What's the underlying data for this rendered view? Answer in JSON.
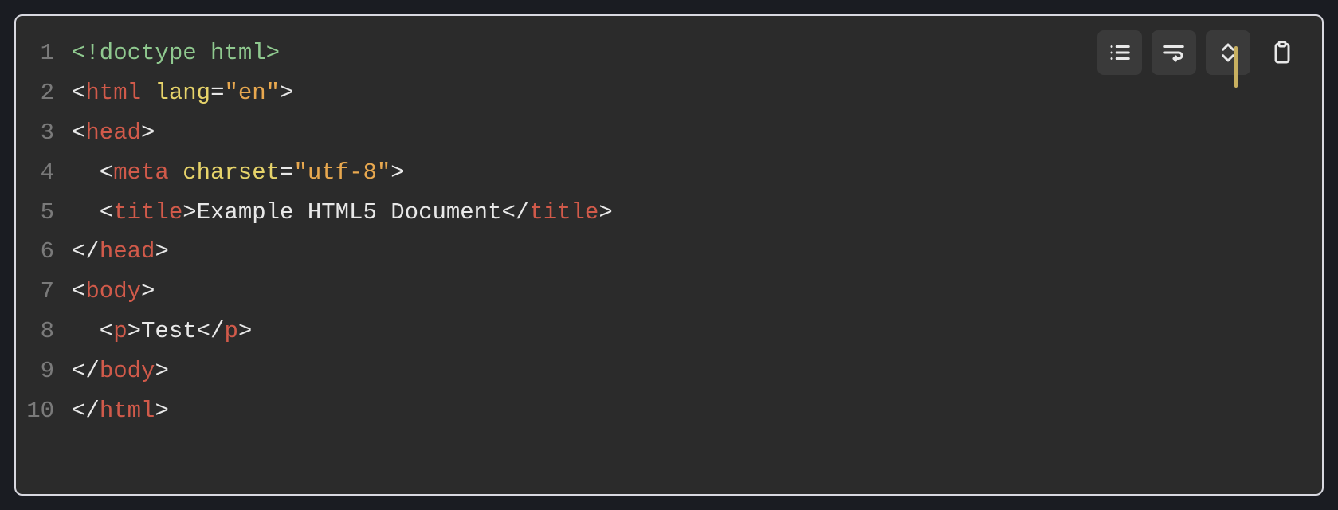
{
  "toolbar": {
    "buttons": [
      {
        "name": "line-numbers-icon",
        "title": "Toggle line numbers"
      },
      {
        "name": "word-wrap-icon",
        "title": "Toggle word wrap"
      },
      {
        "name": "expand-icon",
        "title": "Expand"
      },
      {
        "name": "copy-icon",
        "title": "Copy to clipboard"
      }
    ]
  },
  "code": {
    "language": "html",
    "line_numbers": [
      "1",
      "2",
      "3",
      "4",
      "5",
      "6",
      "7",
      "8",
      "9",
      "10"
    ],
    "plain": "<!doctype html>\n<html lang=\"en\">\n<head>\n  <meta charset=\"utf-8\">\n  <title>Example HTML5 Document</title>\n</head>\n<body>\n  <p>Test</p>\n</body>\n</html>",
    "lines": [
      {
        "indent": 0,
        "tokens": [
          {
            "t": "doctype",
            "v": "<!doctype html>"
          }
        ]
      },
      {
        "indent": 0,
        "tokens": [
          {
            "t": "bracket",
            "v": "<"
          },
          {
            "t": "tag",
            "v": "html"
          },
          {
            "t": "text",
            "v": " "
          },
          {
            "t": "attr",
            "v": "lang"
          },
          {
            "t": "op",
            "v": "="
          },
          {
            "t": "str",
            "v": "\"en\""
          },
          {
            "t": "bracket",
            "v": ">"
          }
        ]
      },
      {
        "indent": 0,
        "tokens": [
          {
            "t": "bracket",
            "v": "<"
          },
          {
            "t": "tag",
            "v": "head"
          },
          {
            "t": "bracket",
            "v": ">"
          }
        ]
      },
      {
        "indent": 1,
        "tokens": [
          {
            "t": "bracket",
            "v": "<"
          },
          {
            "t": "tag",
            "v": "meta"
          },
          {
            "t": "text",
            "v": " "
          },
          {
            "t": "attr",
            "v": "charset"
          },
          {
            "t": "op",
            "v": "="
          },
          {
            "t": "str",
            "v": "\"utf-8\""
          },
          {
            "t": "bracket",
            "v": ">"
          }
        ]
      },
      {
        "indent": 1,
        "tokens": [
          {
            "t": "bracket",
            "v": "<"
          },
          {
            "t": "tag",
            "v": "title"
          },
          {
            "t": "bracket",
            "v": ">"
          },
          {
            "t": "text",
            "v": "Example HTML5 Document"
          },
          {
            "t": "bracket",
            "v": "</"
          },
          {
            "t": "tag",
            "v": "title"
          },
          {
            "t": "bracket",
            "v": ">"
          }
        ]
      },
      {
        "indent": 0,
        "tokens": [
          {
            "t": "bracket",
            "v": "</"
          },
          {
            "t": "tag",
            "v": "head"
          },
          {
            "t": "bracket",
            "v": ">"
          }
        ]
      },
      {
        "indent": 0,
        "tokens": [
          {
            "t": "bracket",
            "v": "<"
          },
          {
            "t": "tag",
            "v": "body"
          },
          {
            "t": "bracket",
            "v": ">"
          }
        ]
      },
      {
        "indent": 1,
        "tokens": [
          {
            "t": "bracket",
            "v": "<"
          },
          {
            "t": "tag",
            "v": "p"
          },
          {
            "t": "bracket",
            "v": ">"
          },
          {
            "t": "text",
            "v": "Test"
          },
          {
            "t": "bracket",
            "v": "</"
          },
          {
            "t": "tag",
            "v": "p"
          },
          {
            "t": "bracket",
            "v": ">"
          }
        ]
      },
      {
        "indent": 0,
        "tokens": [
          {
            "t": "bracket",
            "v": "</"
          },
          {
            "t": "tag",
            "v": "body"
          },
          {
            "t": "bracket",
            "v": ">"
          }
        ]
      },
      {
        "indent": 0,
        "tokens": [
          {
            "t": "bracket",
            "v": "</"
          },
          {
            "t": "tag",
            "v": "html"
          },
          {
            "t": "bracket",
            "v": ">"
          }
        ]
      }
    ]
  }
}
